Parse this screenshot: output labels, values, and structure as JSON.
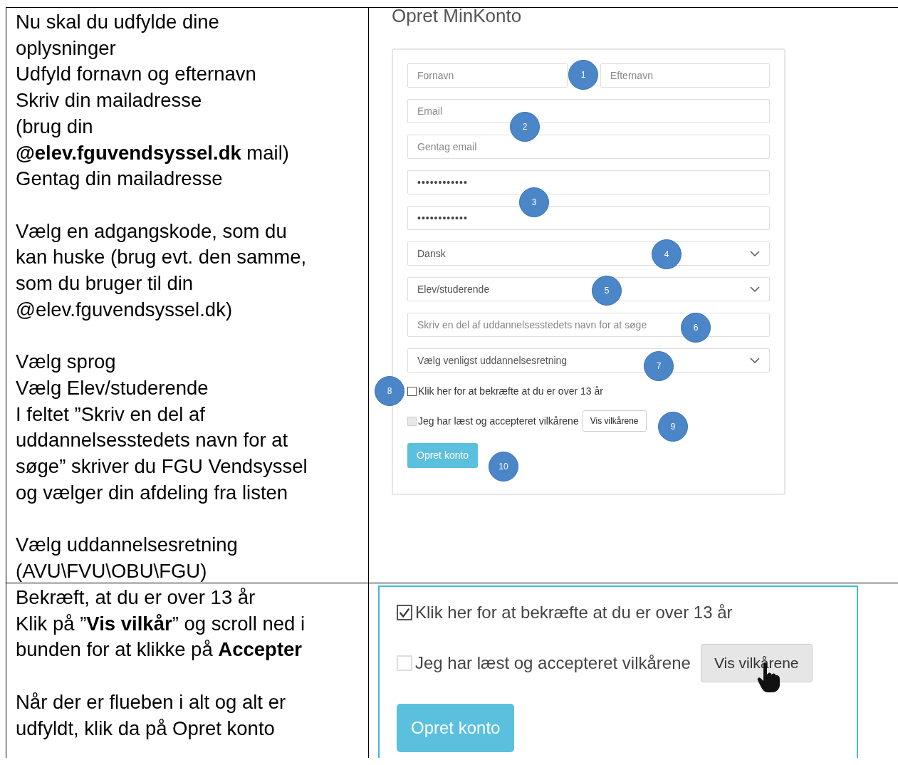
{
  "rows": [
    {
      "instructions": [
        [
          "Nu skal du udfylde dine",
          "oplysninger",
          "Udfyld fornavn og efternavn",
          "Skriv din mailadresse",
          "(brug din",
          "**@elev.fguvendsyssel.dk** mail)",
          "Gentag din mailadresse"
        ],
        [
          "Vælg en adgangskode, som du",
          "kan huske (brug evt. den samme,",
          "som du bruger til din",
          "@elev.fguvendsyssel.dk)"
        ],
        [
          "Vælg sprog",
          "Vælg Elev/studerende",
          "I feltet ”Skriv en del af",
          "uddannelsesstedets navn for at",
          "søge” skriver du FGU Vendsyssel",
          "og vælger din afdeling fra listen"
        ],
        [
          "Vælg uddannelsesretning",
          "(AVU\\FVU\\OBU\\FGU)"
        ]
      ],
      "form": {
        "title": "Opret MinKonto",
        "controls": [
          {
            "kind": "input_pair",
            "fields": [
              {
                "placeholder": "Fornavn"
              },
              {
                "placeholder": "Efternavn"
              }
            ]
          },
          {
            "kind": "input",
            "placeholder": "Email"
          },
          {
            "kind": "input",
            "placeholder": "Gentag email"
          },
          {
            "kind": "password",
            "value": "••••••••••••"
          },
          {
            "kind": "password",
            "value": "••••••••••••"
          },
          {
            "kind": "select",
            "value": "Dansk"
          },
          {
            "kind": "select",
            "value": "Elev/studerende"
          },
          {
            "kind": "input",
            "placeholder": "Skriv en del af uddannelsesstedets navn for at søge"
          },
          {
            "kind": "select",
            "value": "Vælg venligst uddannelsesretning"
          },
          {
            "kind": "checkbox",
            "label": "Klik her for at bekræfte at du er over 13 år",
            "checked": false
          },
          {
            "kind": "checkbox",
            "label": "Jeg har læst og accepteret vilkårene",
            "checked": false,
            "button": "Vis vilkårene"
          },
          {
            "kind": "submit",
            "label": "Opret konto"
          }
        ],
        "markers": [
          "1",
          "2",
          "3",
          "4",
          "5",
          "6",
          "7",
          "8",
          "9",
          "10"
        ]
      }
    },
    {
      "instructions": [
        [
          "Bekræft, at du er over 13 år",
          "Klik på ”**Vis vilkår**” og scroll ned i",
          "bunden for at klikke på **Accepter**"
        ],
        [
          "Når der er flueben i alt og alt er",
          "udfyldt, klik da på Opret konto"
        ]
      ],
      "closeup": {
        "controls": [
          {
            "kind": "checkbox",
            "label": "Klik her for at bekræfte at du er over 13 år",
            "checked": true
          },
          {
            "kind": "checkbox",
            "label": "Jeg har læst og accepteret vilkårene",
            "checked": false,
            "button": "Vis vilkårene",
            "hovered": true
          },
          {
            "kind": "submit",
            "label": "Opret konto"
          }
        ]
      }
    }
  ]
}
